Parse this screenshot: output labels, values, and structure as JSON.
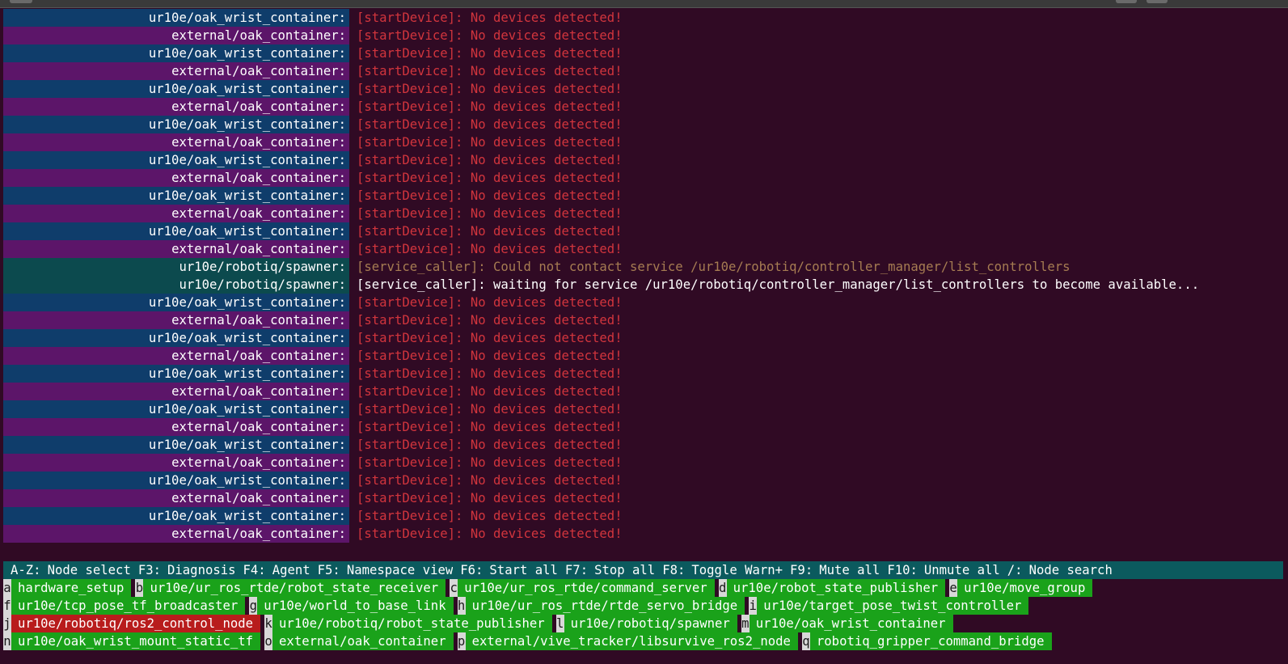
{
  "log": [
    {
      "node": "ur10e/oak_wrist_container:",
      "kind": "wrist",
      "level": "err",
      "text": "[startDevice]: No devices detected!"
    },
    {
      "node": "external/oak_container:",
      "kind": "ext",
      "level": "err",
      "text": "[startDevice]: No devices detected!"
    },
    {
      "node": "ur10e/oak_wrist_container:",
      "kind": "wrist",
      "level": "err",
      "text": "[startDevice]: No devices detected!"
    },
    {
      "node": "external/oak_container:",
      "kind": "ext",
      "level": "err",
      "text": "[startDevice]: No devices detected!"
    },
    {
      "node": "ur10e/oak_wrist_container:",
      "kind": "wrist",
      "level": "err",
      "text": "[startDevice]: No devices detected!"
    },
    {
      "node": "external/oak_container:",
      "kind": "ext",
      "level": "err",
      "text": "[startDevice]: No devices detected!"
    },
    {
      "node": "ur10e/oak_wrist_container:",
      "kind": "wrist",
      "level": "err",
      "text": "[startDevice]: No devices detected!"
    },
    {
      "node": "external/oak_container:",
      "kind": "ext",
      "level": "err",
      "text": "[startDevice]: No devices detected!"
    },
    {
      "node": "ur10e/oak_wrist_container:",
      "kind": "wrist",
      "level": "err",
      "text": "[startDevice]: No devices detected!"
    },
    {
      "node": "external/oak_container:",
      "kind": "ext",
      "level": "err",
      "text": "[startDevice]: No devices detected!"
    },
    {
      "node": "ur10e/oak_wrist_container:",
      "kind": "wrist",
      "level": "err",
      "text": "[startDevice]: No devices detected!"
    },
    {
      "node": "external/oak_container:",
      "kind": "ext",
      "level": "err",
      "text": "[startDevice]: No devices detected!"
    },
    {
      "node": "ur10e/oak_wrist_container:",
      "kind": "wrist",
      "level": "err",
      "text": "[startDevice]: No devices detected!"
    },
    {
      "node": "external/oak_container:",
      "kind": "ext",
      "level": "err",
      "text": "[startDevice]: No devices detected!"
    },
    {
      "node": "ur10e/robotiq/spawner:",
      "kind": "spawn",
      "level": "warn",
      "text": "[service_caller]: Could not contact service /ur10e/robotiq/controller_manager/list_controllers"
    },
    {
      "node": "ur10e/robotiq/spawner:",
      "kind": "spawn",
      "level": "info",
      "text": "[service_caller]: waiting for service /ur10e/robotiq/controller_manager/list_controllers to become available..."
    },
    {
      "node": "ur10e/oak_wrist_container:",
      "kind": "wrist",
      "level": "err",
      "text": "[startDevice]: No devices detected!"
    },
    {
      "node": "external/oak_container:",
      "kind": "ext",
      "level": "err",
      "text": "[startDevice]: No devices detected!"
    },
    {
      "node": "ur10e/oak_wrist_container:",
      "kind": "wrist",
      "level": "err",
      "text": "[startDevice]: No devices detected!"
    },
    {
      "node": "external/oak_container:",
      "kind": "ext",
      "level": "err",
      "text": "[startDevice]: No devices detected!"
    },
    {
      "node": "ur10e/oak_wrist_container:",
      "kind": "wrist",
      "level": "err",
      "text": "[startDevice]: No devices detected!"
    },
    {
      "node": "external/oak_container:",
      "kind": "ext",
      "level": "err",
      "text": "[startDevice]: No devices detected!"
    },
    {
      "node": "ur10e/oak_wrist_container:",
      "kind": "wrist",
      "level": "err",
      "text": "[startDevice]: No devices detected!"
    },
    {
      "node": "external/oak_container:",
      "kind": "ext",
      "level": "err",
      "text": "[startDevice]: No devices detected!"
    },
    {
      "node": "ur10e/oak_wrist_container:",
      "kind": "wrist",
      "level": "err",
      "text": "[startDevice]: No devices detected!"
    },
    {
      "node": "external/oak_container:",
      "kind": "ext",
      "level": "err",
      "text": "[startDevice]: No devices detected!"
    },
    {
      "node": "ur10e/oak_wrist_container:",
      "kind": "wrist",
      "level": "err",
      "text": "[startDevice]: No devices detected!"
    },
    {
      "node": "external/oak_container:",
      "kind": "ext",
      "level": "err",
      "text": "[startDevice]: No devices detected!"
    },
    {
      "node": "ur10e/oak_wrist_container:",
      "kind": "wrist",
      "level": "err",
      "text": "[startDevice]: No devices detected!"
    },
    {
      "node": "external/oak_container:",
      "kind": "ext",
      "level": "err",
      "text": "[startDevice]: No devices detected!"
    }
  ],
  "hotkeys": [
    {
      "key": "A-Z:",
      "label": "Node select"
    },
    {
      "key": "F3:",
      "label": "Diagnosis"
    },
    {
      "key": "F4:",
      "label": "Agent"
    },
    {
      "key": "F5:",
      "label": "Namespace view"
    },
    {
      "key": "F6:",
      "label": "Start all"
    },
    {
      "key": "F7:",
      "label": "Stop all"
    },
    {
      "key": "F8:",
      "label": "Toggle Warn+"
    },
    {
      "key": "F9:",
      "label": "Mute all"
    },
    {
      "key": "F10:",
      "label": "Unmute all"
    },
    {
      "key": "/:",
      "label": "Node search"
    }
  ],
  "node_rows": [
    [
      {
        "key": "a",
        "label": "hardware_setup",
        "status": "ok"
      },
      {
        "key": "b",
        "label": "ur10e/ur_ros_rtde/robot_state_receiver",
        "status": "ok"
      },
      {
        "key": "c",
        "label": "ur10e/ur_ros_rtde/command_server",
        "status": "ok"
      },
      {
        "key": "d",
        "label": "ur10e/robot_state_publisher",
        "status": "ok"
      },
      {
        "key": "e",
        "label": "ur10e/move_group",
        "status": "ok"
      }
    ],
    [
      {
        "key": "f",
        "label": "ur10e/tcp_pose_tf_broadcaster",
        "status": "ok"
      },
      {
        "key": "g",
        "label": "ur10e/world_to_base_link",
        "status": "ok"
      },
      {
        "key": "h",
        "label": "ur10e/ur_ros_rtde/rtde_servo_bridge",
        "status": "ok"
      },
      {
        "key": "i",
        "label": "ur10e/target_pose_twist_controller",
        "status": "ok"
      }
    ],
    [
      {
        "key": "j",
        "label": "ur10e/robotiq/ros2_control_node",
        "status": "err"
      },
      {
        "key": "k",
        "label": "ur10e/robotiq/robot_state_publisher",
        "status": "ok"
      },
      {
        "key": "l",
        "label": "ur10e/robotiq/spawner",
        "status": "ok"
      },
      {
        "key": "m",
        "label": "ur10e/oak_wrist_container",
        "status": "ok"
      }
    ],
    [
      {
        "key": "n",
        "label": "ur10e/oak_wrist_mount_static_tf",
        "status": "ok"
      },
      {
        "key": "o",
        "label": "external/oak_container",
        "status": "ok"
      },
      {
        "key": "p",
        "label": "external/vive_tracker/libsurvive_ros2_node",
        "status": "ok"
      },
      {
        "key": "q",
        "label": "robotiq_gripper_command_bridge",
        "status": "ok"
      }
    ]
  ],
  "colors": {
    "background": "#300a24",
    "wrist_node_bg": "#0f3d6b",
    "external_node_bg": "#5c1569",
    "spawner_node_bg": "#0c4a4e",
    "error_text": "#d2353d",
    "warn_text": "#a67c52",
    "hotkey_bar": "#0b5a5e",
    "node_ok": "#1aa21a",
    "node_err": "#b81c1c"
  }
}
